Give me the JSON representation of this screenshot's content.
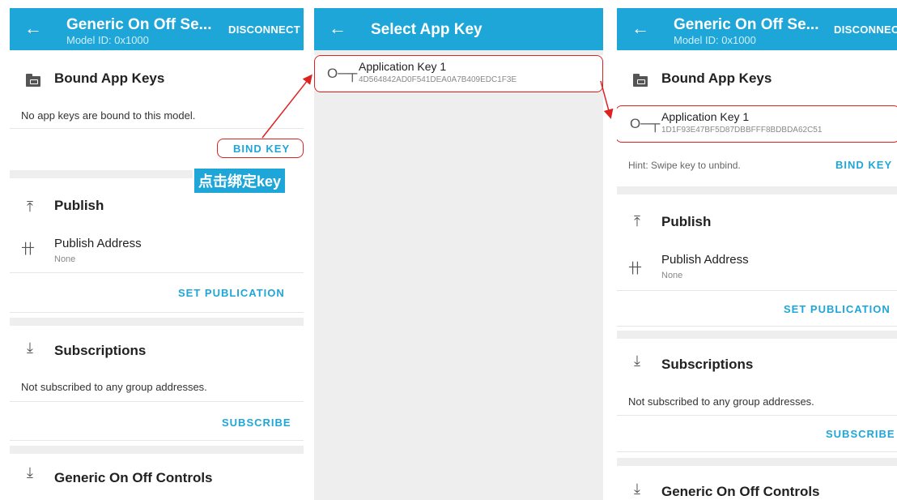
{
  "left": {
    "appbar": {
      "title": "Generic On Off Se...",
      "subtitle": "Model ID: 0x1000",
      "action": "DISCONNECT"
    },
    "bound_app_keys": {
      "title": "Bound App Keys",
      "empty_text": "No app keys are bound to this model.",
      "button": "BIND KEY"
    },
    "annotation": "点击绑定key",
    "publish": {
      "title": "Publish",
      "address_label": "Publish Address",
      "address_value": "None",
      "button": "SET PUBLICATION"
    },
    "subscriptions": {
      "title": "Subscriptions",
      "empty_text": "Not subscribed to any group addresses.",
      "button": "SUBSCRIBE"
    },
    "controls": {
      "title": "Generic On Off Controls"
    }
  },
  "middle": {
    "appbar": {
      "title": "Select App Key"
    },
    "key": {
      "name": "Application Key 1",
      "value": "4D564842AD0F541DEA0A7B409EDC1F3E"
    }
  },
  "right": {
    "appbar": {
      "title": "Generic On Off Se...",
      "subtitle": "Model ID: 0x1000",
      "action": "DISCONNECT"
    },
    "bound_app_keys": {
      "title": "Bound App Keys",
      "hint": "Hint: Swipe key to unbind.",
      "button": "BIND KEY"
    },
    "key": {
      "name": "Application Key 1",
      "value": "1D1F93E47BF5D87DBBFFF8BDBDA62C51"
    },
    "publish": {
      "title": "Publish",
      "address_label": "Publish Address",
      "address_value": "None",
      "button": "SET PUBLICATION"
    },
    "subscriptions": {
      "title": "Subscriptions",
      "empty_text": "Not subscribed to any group addresses.",
      "button": "SUBSCRIBE"
    },
    "controls": {
      "title": "Generic On Off Controls"
    }
  },
  "icons": {
    "back": "arrow-left",
    "folder": "folder-key",
    "key": "key",
    "publish": "publish-upload",
    "network": "network-tree",
    "download": "download"
  },
  "colors": {
    "accent": "#1fa6d8",
    "annotation": "#dd2222"
  }
}
